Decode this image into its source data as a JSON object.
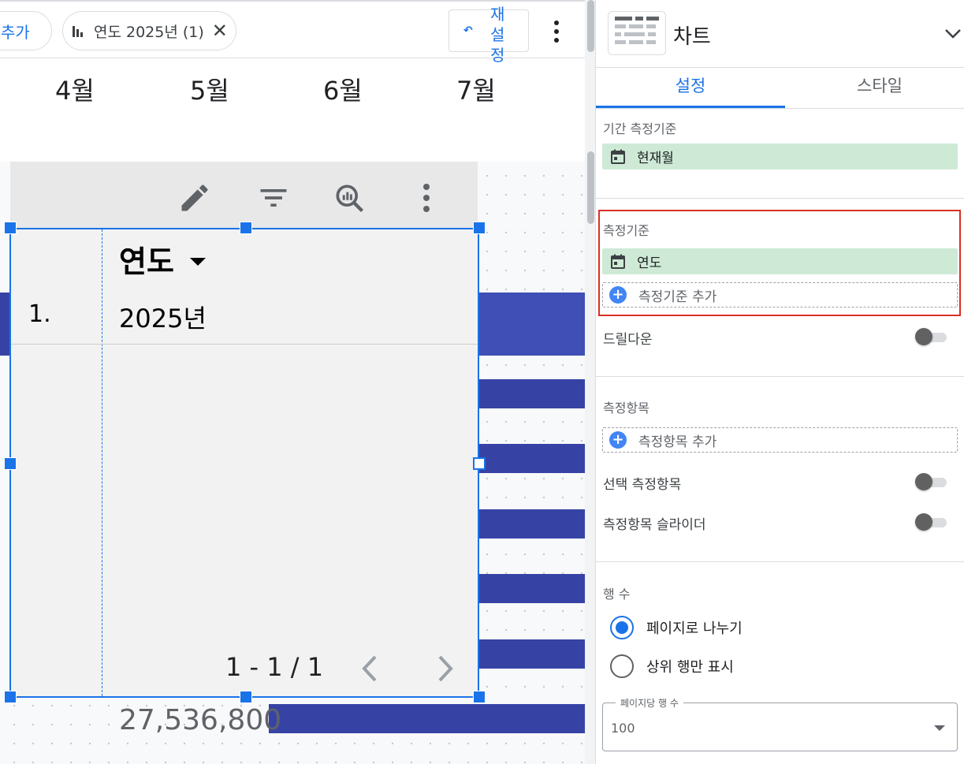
{
  "canvas": {
    "filter_bar": {
      "add_chip_label": "추가",
      "year_chip_label": "연도 2025년 (1)",
      "reset_button_label": "재설정"
    },
    "months": [
      "4월",
      "5월",
      "6월",
      "7월"
    ],
    "table": {
      "header": "연도",
      "rows": [
        {
          "index": "1.",
          "value": "2025년"
        }
      ],
      "pagination": "1 - 1 / 1"
    },
    "bottom_value": "27,536,800"
  },
  "panel": {
    "header": {
      "title": "차트",
      "chart_icon": "table-chart-icon"
    },
    "tabs": [
      {
        "label": "설정",
        "active": true
      },
      {
        "label": "스타일",
        "active": false
      }
    ],
    "date_range_dimension": {
      "label": "기간 측정기준",
      "field": "현재월"
    },
    "dimension": {
      "label": "측정기준",
      "field": "연도",
      "add_label": "측정기준 추가"
    },
    "drilldown": {
      "label": "드릴다운",
      "enabled": false
    },
    "metric": {
      "label": "측정항목",
      "add_label": "측정항목 추가"
    },
    "optional_metrics": {
      "label": "선택 측정항목",
      "enabled": false
    },
    "metric_slider": {
      "label": "측정항목 슬라이더",
      "enabled": false
    },
    "rows": {
      "label": "행 수",
      "options": [
        {
          "label": "페이지로 나누기",
          "selected": true
        },
        {
          "label": "상위 행만 표시",
          "selected": false
        }
      ],
      "rows_per_page_label": "페이지당 행 수",
      "rows_per_page_value": "100"
    }
  },
  "colors": {
    "accent": "#1a73e8",
    "bar": "#3643a5",
    "dimension_pill": "#ceead6",
    "highlight_border": "#d93025"
  }
}
